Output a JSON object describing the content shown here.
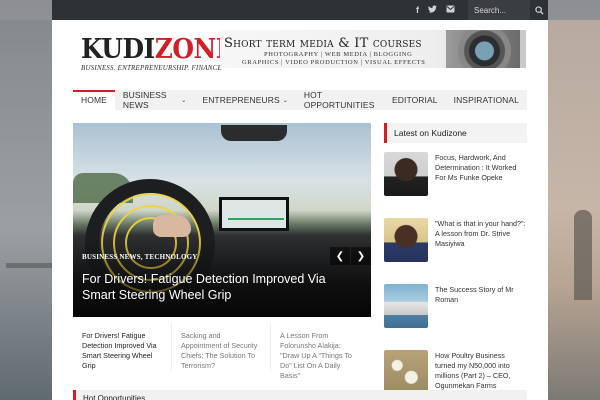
{
  "topbar": {
    "social": [
      {
        "icon": "facebook-icon",
        "glyph": "f"
      },
      {
        "icon": "twitter-icon",
        "glyph": "🐦"
      },
      {
        "icon": "email-icon",
        "glyph": "✉"
      }
    ],
    "search_placeholder": "Search...",
    "search_icon": "search-icon"
  },
  "logo": {
    "name_part1": "KUDI",
    "name_part2": "ZONE",
    "tagline": "BUSINESS. ENTREPRENEURSHIP. FINANCE"
  },
  "banner": {
    "title": "Short term media & IT courses",
    "line1": "PHOTOGRAPHY | WEB MEDIA | BLOGGING",
    "line2": "GRAPHICS | VIDEO PRODUCTION | VISUAL EFFECTS"
  },
  "nav": {
    "items": [
      {
        "label": "HOME",
        "active": true,
        "dropdown": false
      },
      {
        "label": "BUSINESS NEWS",
        "active": false,
        "dropdown": true
      },
      {
        "label": "ENTREPRENEURS",
        "active": false,
        "dropdown": true
      },
      {
        "label": "HOT OPPORTUNITIES",
        "active": false,
        "dropdown": false
      },
      {
        "label": "EDITORIAL",
        "active": false,
        "dropdown": false
      },
      {
        "label": "INSPIRATIONAL",
        "active": false,
        "dropdown": false
      }
    ]
  },
  "slider": {
    "categories": "BUSINESS NEWS, TECHNOLOGY",
    "headline": "For Drivers! Fatigue Detection Improved Via Smart Steering Wheel Grip",
    "prev_icon": "chevron-left-icon",
    "next_icon": "chevron-right-icon"
  },
  "thumbs": [
    {
      "title": "For Drivers! Fatigue Detection Improved Via Smart Steering Wheel Grip"
    },
    {
      "title": "Sacking and Appointment of Security Chiefs; The Solution To Terrorism?"
    },
    {
      "title": "A Lesson From Folorunsho Alakija: \"Draw Up A “Things To Do” List On A Daily Basis\""
    }
  ],
  "sidebar": {
    "heading": "Latest on Kudizone",
    "posts": [
      {
        "title": "Focus, Hardwork, And Determination : It Worked For Ms Funke Opeke"
      },
      {
        "title": "\"What is that in your hand?\": A lesson from Dr. Strive Masiyiwa"
      },
      {
        "title": "The Success Story of Mr Roman"
      },
      {
        "title": "How Poultry Business turned my N50,000 into millions (Part 2) – CEO, Ogunmekan Farms"
      }
    ]
  },
  "hot_section": {
    "heading": "Hot Opportunities"
  },
  "colors": {
    "accent": "#d21f26",
    "topbar": "#2f3235"
  }
}
